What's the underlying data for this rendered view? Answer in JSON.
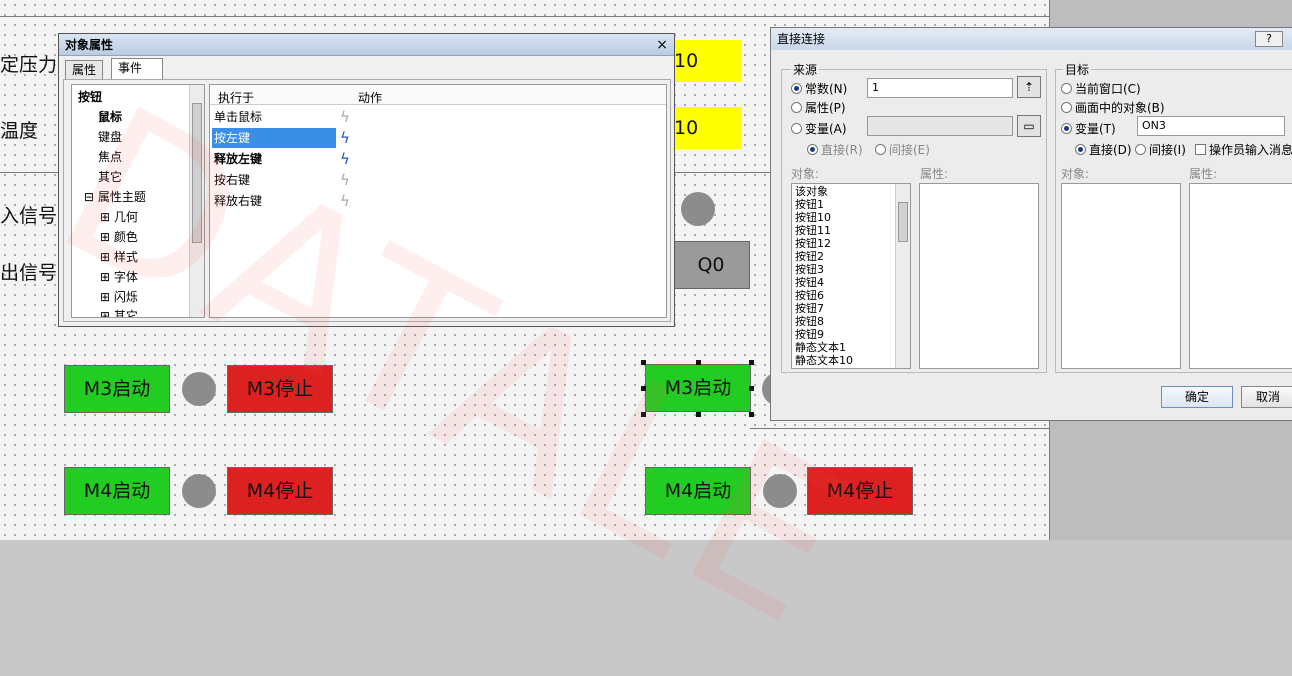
{
  "canvas": {
    "label_pressure": "定压力",
    "label_temperature": "温度",
    "label_input_signal": "入信号",
    "label_output_signal": "出信号",
    "yellow_1_value": "10",
    "yellow_2_value": "10",
    "q0_button": "Q0",
    "m3_start": "M3启动",
    "m3_stop": "M3停止",
    "m4_start": "M4启动",
    "m4_stop": "M4停止"
  },
  "object_dialog": {
    "title": "对象属性",
    "close": "×",
    "tabs": [
      "属性",
      "事件"
    ],
    "tree": [
      "按钮",
      "鼠标",
      "键盘",
      "焦点",
      "其它",
      "属性主题",
      "几何",
      "颜色",
      "样式",
      "字体",
      "闪烁",
      "其它"
    ],
    "grid_headers": [
      "执行于",
      "动作"
    ],
    "events": [
      "单击鼠标",
      "按左键",
      "释放左键",
      "按右键",
      "释放右键"
    ],
    "selected_event": "按左键"
  },
  "connect_dialog": {
    "title": "直接连接",
    "help": "?",
    "source_label": "来源",
    "source_constant": "常数(N)",
    "source_constant_value": "1",
    "source_property": "属性(P)",
    "source_variable": "变量(A)",
    "source_direct": "直接(R)",
    "source_indirect": "间接(E)",
    "source_object_label": "对象:",
    "source_property_label": "属性:",
    "source_objects": [
      "该对象",
      "按钮1",
      "按钮10",
      "按钮11",
      "按钮12",
      "按钮2",
      "按钮3",
      "按钮4",
      "按钮6",
      "按钮7",
      "按钮8",
      "按钮9",
      "静态文本1",
      "静态文本10"
    ],
    "target_label": "目标",
    "target_current_window": "当前窗口(C)",
    "target_object_in_screen": "画面中的对象(B)",
    "target_variable": "变量(T)",
    "target_variable_value": "ON3",
    "target_direct": "直接(D)",
    "target_indirect": "间接(I)",
    "target_operator_msg": "操作员输入消息",
    "target_object_label": "对象:",
    "target_property_label": "属性:",
    "ok": "确定",
    "cancel": "取消"
  },
  "colors": {
    "green": "#22cc22",
    "red": "#dd2020",
    "yellow": "#ffff00",
    "selection_blue": "#3a8ee6"
  }
}
